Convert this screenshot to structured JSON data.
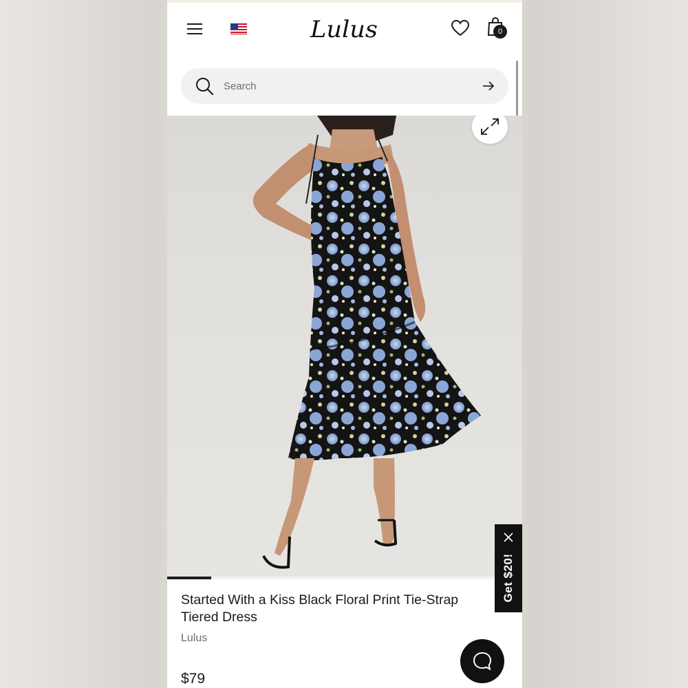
{
  "header": {
    "menu_icon": "hamburger-menu-icon",
    "region_icon": "us-flag-icon",
    "logo_text": "Lulus",
    "wishlist_icon": "heart-icon",
    "cart_icon": "shopping-bag-icon",
    "cart_count": "0"
  },
  "search": {
    "placeholder": "Search",
    "value": "",
    "search_icon": "magnifier-icon",
    "submit_icon": "arrow-right-icon"
  },
  "gallery": {
    "image_alt": "Started With a Kiss Black Floral Print Tie-Strap Tiered Dress",
    "expand_icon": "expand-arrows-icon",
    "current_slide_indicator": "slide-indicator"
  },
  "promo": {
    "label": "Get $20!",
    "close_icon": "close-icon"
  },
  "product": {
    "title": "Started With a Kiss Black Floral Print Tie-Strap Tiered Dress",
    "brand": "Lulus",
    "price": "$79"
  },
  "chat": {
    "icon": "chat-bubble-icon"
  },
  "colors": {
    "text_primary": "#1a1a1a",
    "text_secondary": "#6c6c6c",
    "search_bg": "#f1f1f1",
    "promo_bg": "#111111",
    "dress_black": "#141414",
    "dress_flower_blue": "#8aa6d6"
  }
}
